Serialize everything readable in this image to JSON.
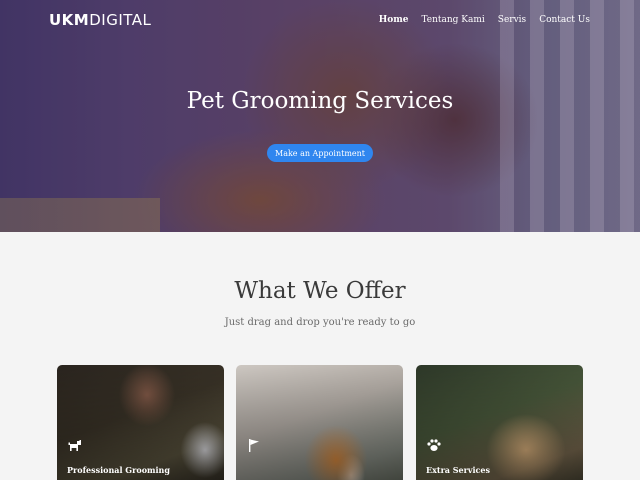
{
  "header": {
    "logo_bold": "UKM",
    "logo_light": "DIGITAL",
    "nav": [
      {
        "label": "Home",
        "active": true
      },
      {
        "label": "Tentang Kami",
        "active": false
      },
      {
        "label": "Servis",
        "active": false
      },
      {
        "label": "Contact Us",
        "active": false
      }
    ]
  },
  "hero": {
    "title": "Pet Grooming Services",
    "cta_label": "Make an Appointment",
    "cta_color": "#2f86ef"
  },
  "offer": {
    "title": "What We Offer",
    "subtitle": "Just drag and drop you're ready to go",
    "cards": [
      {
        "label": "Professional Grooming",
        "icon": "dog-icon"
      },
      {
        "label": "",
        "icon": "flag-icon"
      },
      {
        "label": "Extra Services",
        "icon": "paw-icon"
      }
    ]
  }
}
